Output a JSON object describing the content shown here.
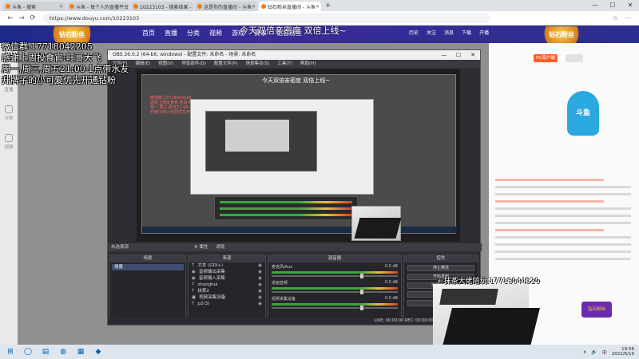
{
  "browser": {
    "tabs": [
      {
        "label": "斗鱼 - 搜索",
        "active": false
      },
      {
        "label": "斗鱼 - 每个人的直播平台",
        "active": false
      },
      {
        "label": "10223103 - 搜索结果 - 斗鱼",
        "active": false
      },
      {
        "label": "这是你的直播间 - 斗鱼",
        "active": false
      },
      {
        "label": "钻石粉丝直播间 - 斗鱼",
        "active": true
      }
    ],
    "new_tab": "+",
    "window_controls": [
      "—",
      "☐",
      "✕"
    ],
    "url": "https://www.douyu.com/10223103",
    "nav": {
      "back": "←",
      "forward": "→",
      "reload": "⟳"
    },
    "addr_icons": [
      "☆",
      "⋯"
    ]
  },
  "site": {
    "logo": "钻石粉丝",
    "nav_items": [
      "首页",
      "直播",
      "分类",
      "视频",
      "游戏",
      "赛事",
      "钻石粉丝"
    ],
    "header_icons": [
      "历史",
      "关注",
      "消息",
      "下载",
      "开播"
    ],
    "right_logo": "钻石粉丝",
    "rail": [
      "推荐",
      "直播",
      "分类",
      "视频"
    ],
    "follow_button": "PC客户端",
    "mascot": "斗鱼",
    "bottom_badge": "钻石粉丝"
  },
  "overlay": {
    "marquee": "今天双倍亲密度 双倍上线~",
    "lines": [
      "微信群:17718042205",
      "感谢上周投食官:旺哥大飞",
      "周一,周三,周五21:00-1点带水友",
      "升牌子的小可爱优先开通钻粉"
    ],
    "contact": "←抹茶大佬陪玩:17718044520"
  },
  "obs": {
    "title": "OBS 26.0.2 (64-bit, windows) - 配置文件: 未命名 - 场景: 未命名",
    "menu": [
      "文件(F)",
      "编辑(E)",
      "视图(V)",
      "停靠部件(D)",
      "配置文件(P)",
      "场景集合(S)",
      "工具(T)",
      "帮助(H)"
    ],
    "inner_title": "今天双倍亲密度 双倍上线~",
    "inner_red": [
      "微信群:17718042205",
      "感谢上周投食官:旺哥大飞",
      "周一,周三,周五21:00-1点带水友",
      "升牌子的小可爱优先开通钻粉"
    ],
    "scene_bar": "未选择源",
    "scene_bar_buttons": [
      "⚙ 属性",
      "滤镜"
    ],
    "docks": {
      "scenes": {
        "header": "场景",
        "items": [
          "场景"
        ]
      },
      "sources": {
        "header": "来源",
        "items": [
          {
            "type": "T",
            "label": "文本 (GDI+)"
          },
          {
            "type": "◉",
            "label": "音频输出采集"
          },
          {
            "type": "◉",
            "label": "音频输入采集"
          },
          {
            "type": "T",
            "label": "zhonghui"
          },
          {
            "type": "T",
            "label": "抹茶2"
          },
          {
            "type": "▣",
            "label": "视频采集设备"
          },
          {
            "type": "T",
            "label": "p2(3)"
          }
        ]
      },
      "mixer": {
        "header": "混音器",
        "rows": [
          {
            "label": "麦克风/Aux",
            "db": "0.0 dB"
          },
          {
            "label": "桌面音频",
            "db": "0.0 dB"
          },
          {
            "label": "视频采集设备",
            "db": "0.0 dB"
          }
        ]
      },
      "controls": {
        "header": "控件",
        "buttons": [
          "停止推流",
          "开始录制",
          "工作室模式",
          "设置",
          "退出"
        ]
      }
    },
    "dock_foot": "+ − ∧ ∨",
    "status": "LIVE: 00:00:00   REC: 00:00:00   CPU: 0.9%, 30.00 fps"
  },
  "taskbar": {
    "icons": [
      "⊞",
      "◯",
      "▤",
      "◍",
      "▦",
      "◆"
    ],
    "tray": [
      "∧",
      "🔊",
      "中"
    ],
    "time": "19:56",
    "date": "2022/6/19"
  }
}
